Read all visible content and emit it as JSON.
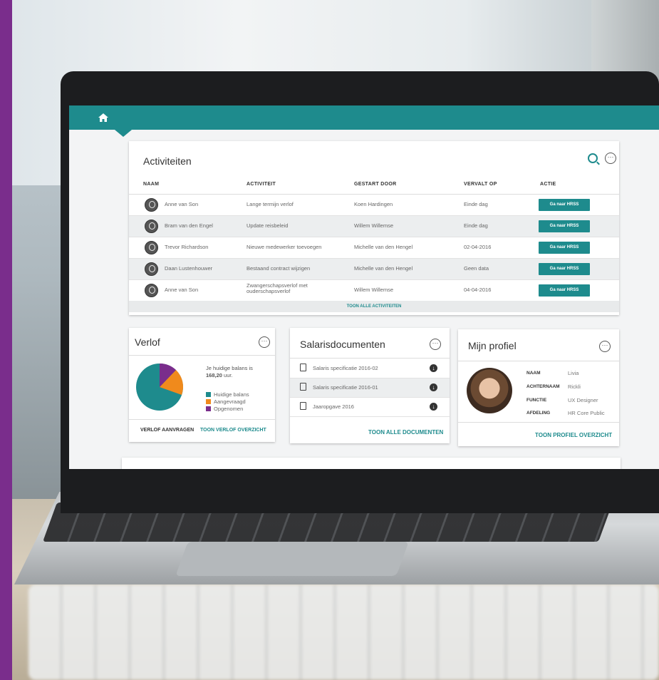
{
  "activities": {
    "title": "Activiteiten",
    "columns": [
      "NAAM",
      "ACTIVITEIT",
      "GESTART DOOR",
      "VERVALT OP",
      "ACTIE"
    ],
    "rows": [
      {
        "naam": "Anne van Son",
        "activiteit": "Lange termijn verlof",
        "gestart": "Koen Hardingen",
        "vervalt": "Einde dag",
        "actie": "Ga naar HRSS"
      },
      {
        "naam": "Bram van den Engel",
        "activiteit": "Update reisbeleid",
        "gestart": "Willem Willemse",
        "vervalt": "Einde dag",
        "actie": "Ga naar HRSS"
      },
      {
        "naam": "Trevor Richardson",
        "activiteit": "Nieuwe medewerker toevoegen",
        "gestart": "Michelle van den Hengel",
        "vervalt": "02-04-2016",
        "actie": "Ga naar HRSS"
      },
      {
        "naam": "Daan Lustenhouwer",
        "activiteit": "Bestaand contract wijzigen",
        "gestart": "Michelle van den Hengel",
        "vervalt": "Geen data",
        "actie": "Ga naar HRSS"
      },
      {
        "naam": "Anne van Son",
        "activiteit": "Zwangerschapsverlof met ouderschapsverlof",
        "gestart": "Willem Willemse",
        "vervalt": "04-04-2016",
        "actie": "Ga naar HRSS"
      }
    ],
    "footer_link": "TOON ALLE ACTIVITEITEN"
  },
  "verlof": {
    "title": "Verlof",
    "balance_text": "Je huidige balans is",
    "balance_value": "168,20",
    "balance_unit": "uur.",
    "legend": [
      "Huidige balans",
      "Aangevraagd",
      "Opgenomen"
    ],
    "colors": {
      "huidige": "#1e8b8d",
      "aangevraagd": "#f08a1c",
      "opgenomen": "#7a2d8c"
    },
    "link_request": "VERLOF AANVRAGEN",
    "link_overview": "TOON VERLOF OVERZICHT"
  },
  "salaris": {
    "title": "Salarisdocumenten",
    "docs": [
      "Salaris specificatie 2016-02",
      "Salaris specificatie 2016-01",
      "Jaaropgave 2016"
    ],
    "link": "TOON ALLE DOCUMENTEN"
  },
  "profiel": {
    "title": "Mijn profiel",
    "fields": [
      {
        "key": "NAAM",
        "value": "Livia"
      },
      {
        "key": "ACHTERNAAM",
        "value": "Rickli"
      },
      {
        "key": "FUNCTIE",
        "value": "UX Designer"
      },
      {
        "key": "AFDELING",
        "value": "HR Core Public"
      }
    ],
    "link": "TOON PROFIEL OVERZICHT"
  },
  "icons": {
    "home": "home-icon",
    "search": "search-icon",
    "more": "more-options-icon",
    "download": "download-icon",
    "document": "document-icon"
  }
}
